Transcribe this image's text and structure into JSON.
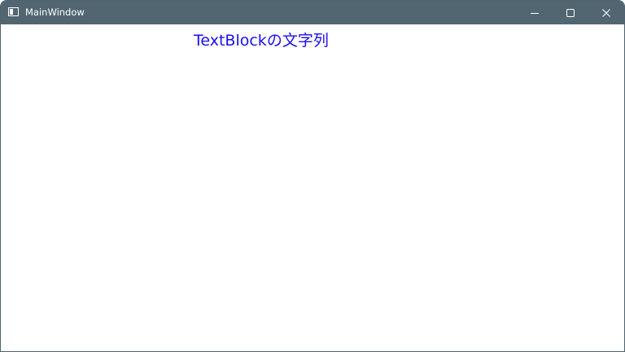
{
  "window": {
    "title": "MainWindow",
    "titlebar_color": "#516671",
    "border_color": "#4f6470"
  },
  "icons": {
    "app": "window-app-icon",
    "minimize": "minimize-icon",
    "maximize": "maximize-icon",
    "close": "close-icon"
  },
  "content": {
    "textblock_text": "TextBlockの文字列",
    "textblock_color": "#1a0ff0",
    "background": "#ffffff"
  }
}
